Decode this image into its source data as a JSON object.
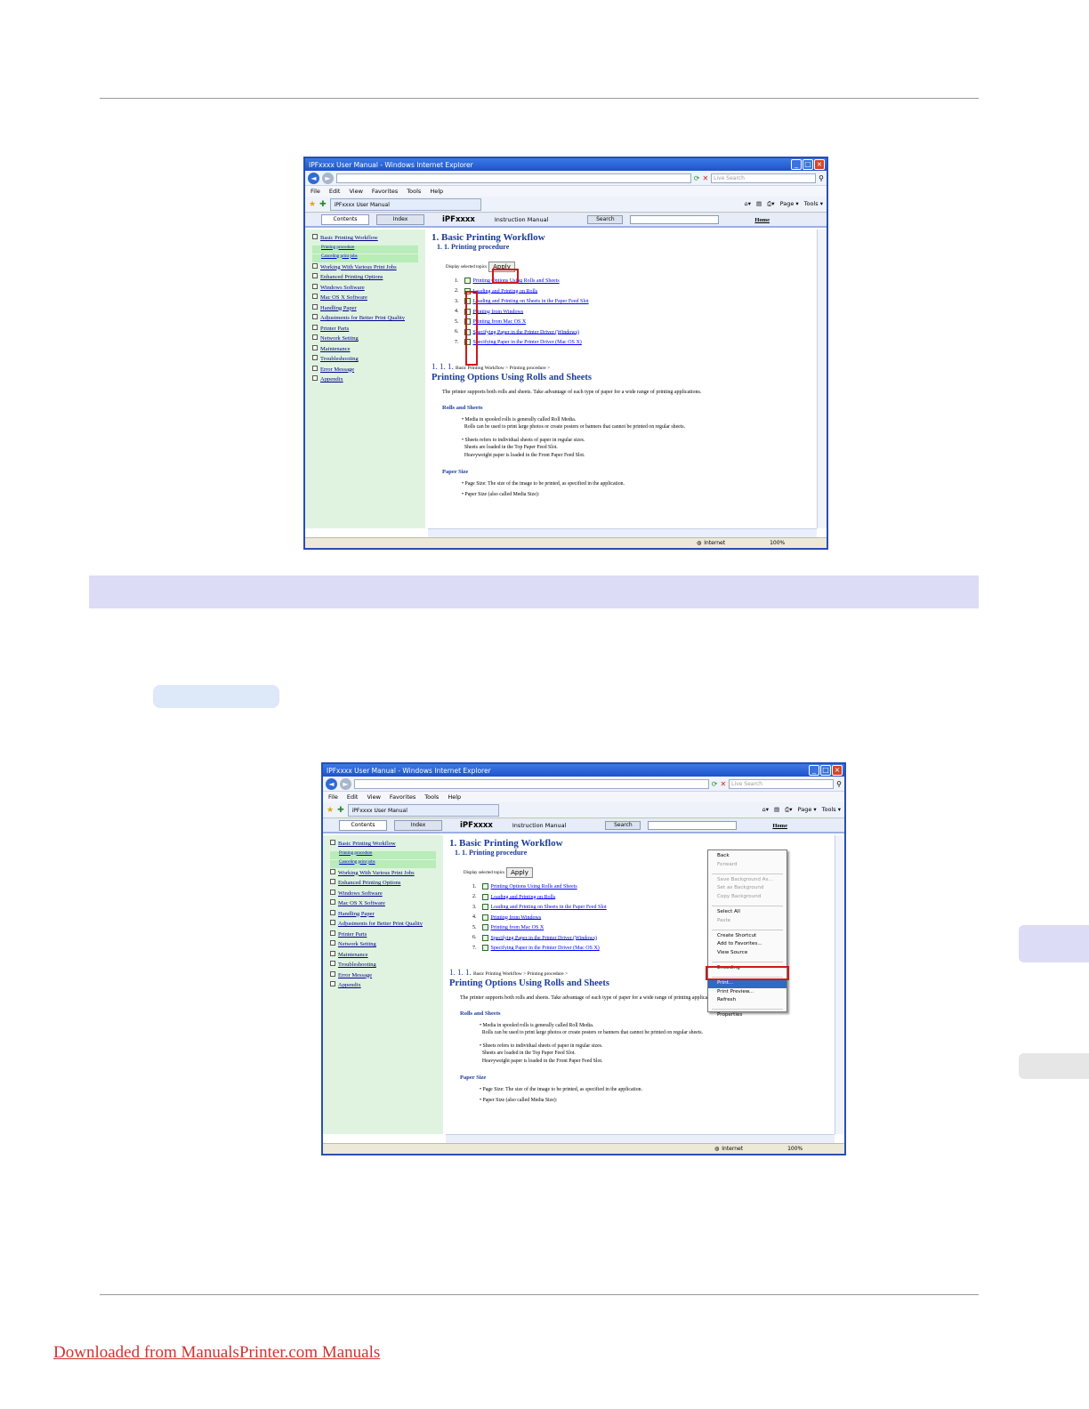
{
  "window": {
    "title": "IPFxxxx User Manual - Windows Internet Explorer",
    "search_placeholder": "Live Search",
    "menu": [
      "File",
      "Edit",
      "View",
      "Favorites",
      "Tools",
      "Help"
    ],
    "page_tab": "iPFxxxx User Manual",
    "right_tools": [
      "Page ▾",
      "Tools ▾"
    ],
    "status_zone": "Internet",
    "zoom": "100%"
  },
  "help_header": {
    "tab_contents": "Contents",
    "tab_index": "Index",
    "brand": "iPFxxxx",
    "subtitle": "Instruction Manual",
    "search_button": "Search",
    "home": "Home"
  },
  "toc": {
    "items": [
      "Basic Printing Workflow",
      "Working With Various Print Jobs",
      "Enhanced Printing Options",
      "Windows Software",
      "Mac OS X Software",
      "Handling Paper",
      "Adjustments for Better Print Quality",
      "Printer Parts",
      "Network Setting",
      "Maintenance",
      "Troubleshooting",
      "Error Message",
      "Appendix"
    ],
    "sub_items": [
      "Printing procedure",
      "Canceling print jobs"
    ]
  },
  "main": {
    "h1": "1. Basic Printing Workflow",
    "h2": "1. 1. Printing procedure",
    "display_label": "Display selected topics",
    "apply": "Apply",
    "topics": [
      {
        "num": "1.",
        "label": "Printing Options Using Rolls and Sheets"
      },
      {
        "num": "2.",
        "label": "Loading and Printing on Rolls"
      },
      {
        "num": "3.",
        "label": "Loading and Printing on Sheets in the Paper Feed Slot"
      },
      {
        "num": "4.",
        "label": "Printing from Windows"
      },
      {
        "num": "5.",
        "label": "Printing from Mac OS X"
      },
      {
        "num": "6.",
        "label": "Specifying Paper in the Printer Driver (Windows)"
      },
      {
        "num": "7.",
        "label": "Specifying Paper in the Printer Driver (Mac OS X)"
      }
    ],
    "crumb_num": "1. 1. 1.",
    "crumb_path": "Basic Printing Workflow > Printing procedure >",
    "h3": "Printing Options Using Rolls and Sheets",
    "intro": "The printer supports both rolls and sheets. Take advantage of each type of paper for a wide range of printing applications.",
    "rolls_heading": "Rolls and Sheets",
    "bullet1_a": "Media in spooled rolls is generally called Roll Media.",
    "bullet1_b": "Rolls can be used to print large photos or create posters or banners that cannot be printed on regular sheets.",
    "bullet2_a": "Sheets refers to individual sheets of paper in regular sizes.",
    "bullet2_b": "Sheets are loaded in the Top Paper Feed Slot.",
    "bullet2_c": "Heavyweight paper is loaded in the Front Paper Feed Slot.",
    "paper_heading": "Paper Size",
    "bullet3": "Page Size: The size of the image to be printed, as specified in the application.",
    "bullet4": "Paper Size (also called Media Size):"
  },
  "context_menu": {
    "items": [
      "Back",
      "Forward",
      "Save Background As...",
      "Set as Background",
      "Copy Background",
      "Select All",
      "Paste",
      "Create Shortcut",
      "Add to Favorites...",
      "View Source",
      "Encoding",
      "Print...",
      "Print Preview...",
      "Refresh",
      "Properties"
    ]
  },
  "footer": {
    "link": "Downloaded from ManualsPrinter.com Manuals"
  }
}
